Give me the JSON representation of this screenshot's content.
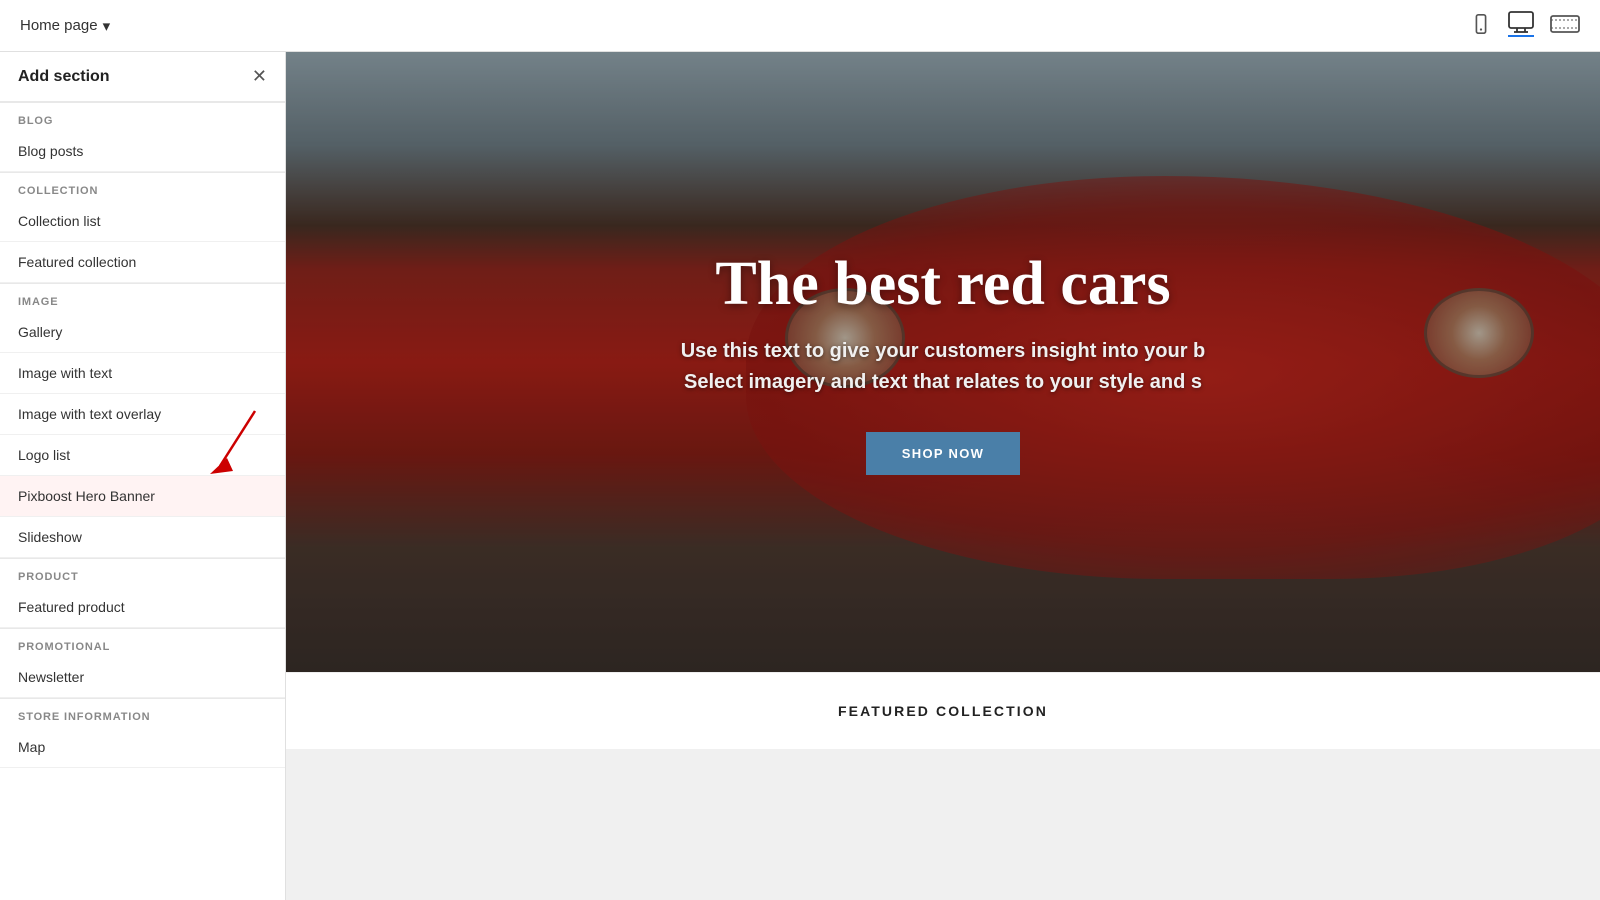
{
  "header": {
    "page_label": "Home page",
    "chevron": "▾"
  },
  "sidebar": {
    "title": "Add section",
    "close_icon": "✕",
    "categories": [
      {
        "id": "blog",
        "label": "BLOG",
        "items": [
          "Blog posts"
        ]
      },
      {
        "id": "collection",
        "label": "COLLECTION",
        "items": [
          "Collection list",
          "Featured collection"
        ]
      },
      {
        "id": "image",
        "label": "IMAGE",
        "items": [
          "Gallery",
          "Image with text",
          "Image with text overlay",
          "Logo list",
          "Pixboost Hero Banner",
          "Slideshow"
        ]
      },
      {
        "id": "product",
        "label": "PRODUCT",
        "items": [
          "Featured product"
        ]
      },
      {
        "id": "promotional",
        "label": "PROMOTIONAL",
        "items": [
          "Newsletter"
        ]
      },
      {
        "id": "store_information",
        "label": "STORE INFORMATION",
        "items": [
          "Map"
        ]
      }
    ]
  },
  "preview": {
    "hero": {
      "title": "The best red cars",
      "subtitle1": "Use this text to give your customers insight into your b",
      "subtitle2": "Select imagery and text that relates to your style and s",
      "button_label": "SHOP NOW"
    },
    "featured_collection": {
      "title": "FEATURED COLLECTION"
    }
  },
  "icons": {
    "mobile": "📱",
    "desktop": "🖥",
    "widescreen": "⬛"
  },
  "colors": {
    "accent_blue": "#1a73e8",
    "hero_btn": "#4a7fa8",
    "category_text": "#888888",
    "arrow_red": "#cc0000"
  }
}
